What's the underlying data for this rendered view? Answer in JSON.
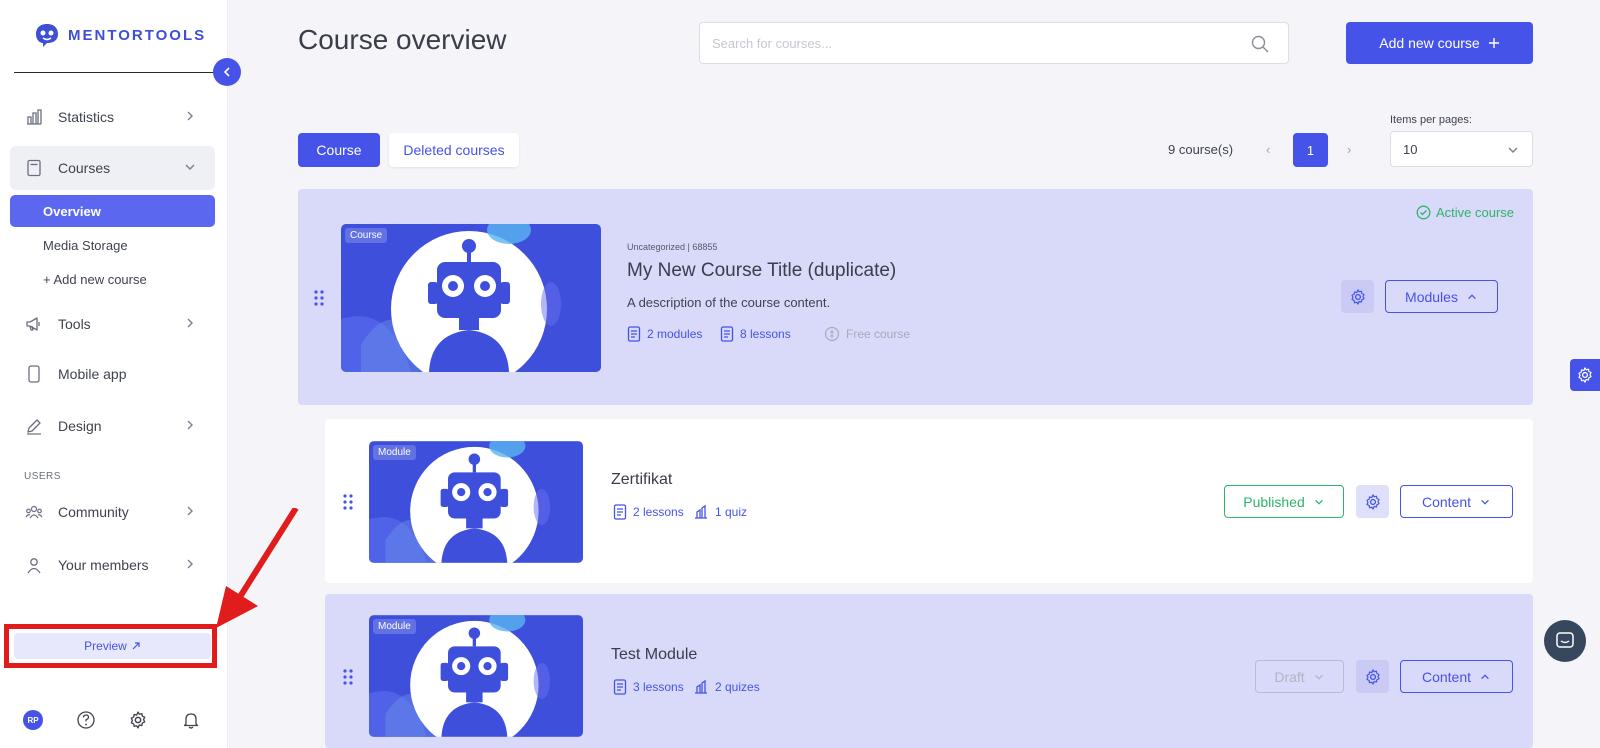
{
  "sidebar": {
    "logo_text": "MENTORTOOLS",
    "items": [
      {
        "label": "Statistics"
      },
      {
        "label": "Courses"
      },
      {
        "label": "Tools"
      },
      {
        "label": "Mobile app"
      },
      {
        "label": "Design"
      },
      {
        "label": "Community"
      },
      {
        "label": "Your members"
      }
    ],
    "courses_sub": [
      {
        "label": "Overview"
      },
      {
        "label": "Media Storage"
      },
      {
        "label": "+ Add new course"
      }
    ],
    "section_users": "USERS",
    "preview_label": "Preview",
    "avatar_initials": "RP"
  },
  "header": {
    "title": "Course overview",
    "search_placeholder": "Search for courses...",
    "add_button_label": "Add new course"
  },
  "toolbar": {
    "tab_course": "Course",
    "tab_deleted": "Deleted courses",
    "count": "9 course(s)",
    "current_page": "1",
    "items_per_page_label": "Items per pages:",
    "items_per_page_value": "10"
  },
  "course": {
    "tag": "Course",
    "meta": "Uncategorized | 68855",
    "title": "My New Course Title (duplicate)",
    "description": "A description of the course content.",
    "modules": "2 modules",
    "lessons": "8 lessons",
    "price": "Free course",
    "status": "Active course",
    "modules_button": "Modules"
  },
  "modules": [
    {
      "tag": "Module",
      "title": "Zertifikat",
      "lessons": "2 lessons",
      "quizzes": "1 quiz",
      "status": "Published",
      "content_button": "Content"
    },
    {
      "tag": "Module",
      "title": "Test Module",
      "lessons": "3 lessons",
      "quizzes": "2 quizes",
      "status": "Draft",
      "content_button": "Content"
    }
  ],
  "colors": {
    "accent": "#4553e8",
    "course_bg": "#d9d9fa",
    "published": "#2fb36a",
    "annotation": "#e01c1c"
  }
}
